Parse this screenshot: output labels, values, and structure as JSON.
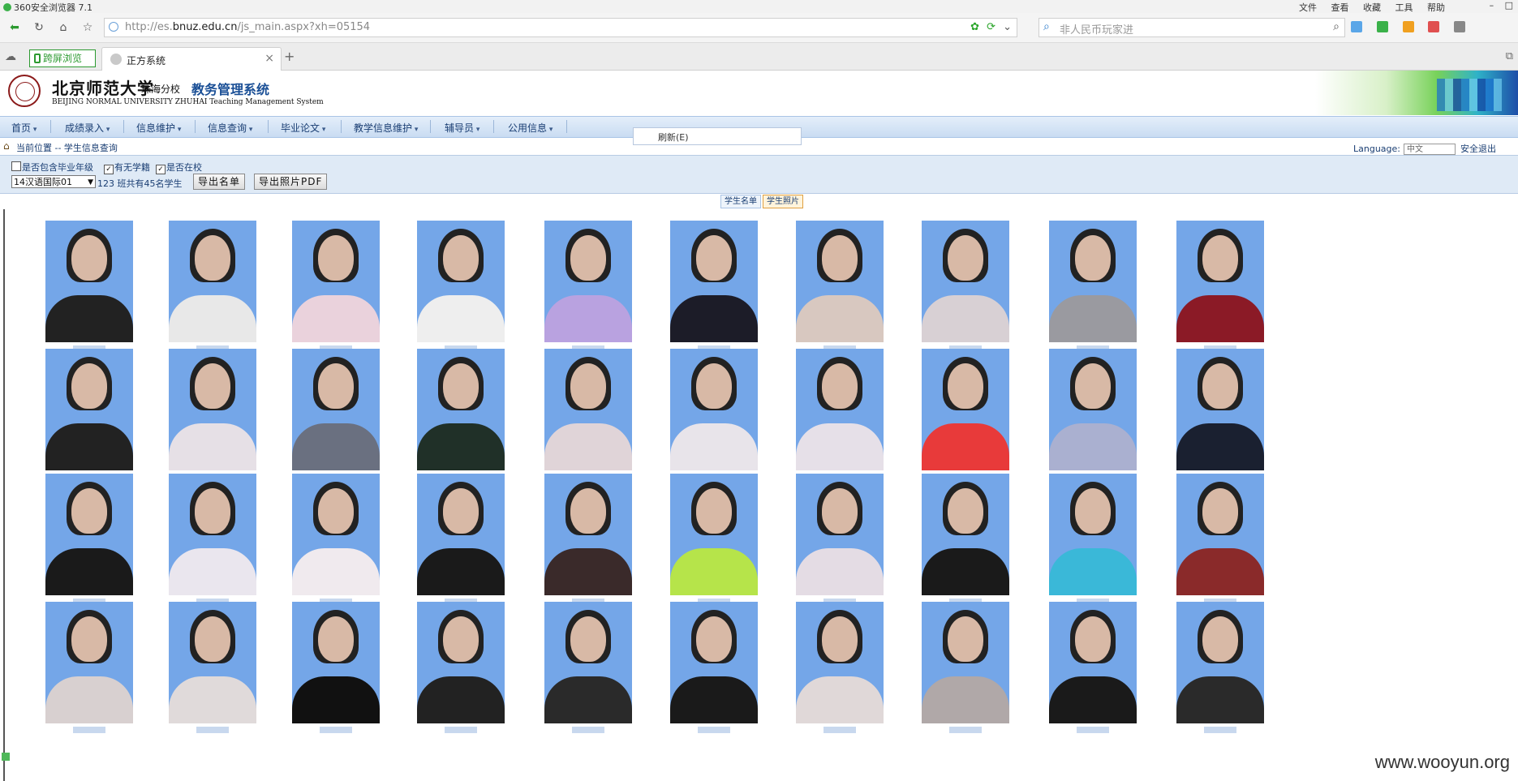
{
  "browser": {
    "title": "360安全浏览器 7.1",
    "menus": [
      "文件",
      "查看",
      "收藏",
      "工具",
      "帮助"
    ],
    "url_prefix": "http://es.",
    "url_domain": "bnuz.edu.cn",
    "url_path": "/js_main.aspx?xh=05154",
    "search_placeholder": "非人民币玩家进",
    "tab_split": "跨屏浏览",
    "tab_active": "正方系统"
  },
  "header": {
    "university": "北京师范大学",
    "campus": "珠海分校",
    "system": "教务管理系统",
    "subline": "BEIJING NORMAL UNIVERSITY ZHUHAI Teaching Management System"
  },
  "menu": {
    "items": [
      "首页",
      "成绩录入",
      "信息维护",
      "信息查询",
      "毕业论文",
      "教学信息维护",
      "辅导员",
      "公用信息"
    ],
    "popup_item": "刷新(E)"
  },
  "breadcrumb": "当前位置 -- 学生信息查询",
  "language": {
    "label": "Language:",
    "value": "中文",
    "logout": "安全退出"
  },
  "filter": {
    "include_grad_label": "是否包含毕业年级",
    "include_grad": false,
    "has_status_label": "有无学籍",
    "has_status": true,
    "in_school_label": "是否在校",
    "in_school": true,
    "class_value": "14汉语国际01",
    "count_text": "123 班共有45名学生",
    "export_list": "导出名单",
    "export_pdf": "导出照片PDF"
  },
  "subtabs": [
    "学生名单",
    "学生照片"
  ],
  "watermark": "www.wooyun.org",
  "photos": [
    {
      "body": "#222"
    },
    {
      "body": "#e8e8e8"
    },
    {
      "body": "#ead2dc"
    },
    {
      "body": "#eeeeee"
    },
    {
      "body": "#b9a2e0"
    },
    {
      "body": "#1c1c28"
    },
    {
      "body": "#d8c8c0"
    },
    {
      "body": "#d8d0d4"
    },
    {
      "body": "#9a9aa0"
    },
    {
      "body": "#8b1a26"
    },
    {
      "body": "#222"
    },
    {
      "body": "#e6e0e6"
    },
    {
      "body": "#6a7080"
    },
    {
      "body": "#203028"
    },
    {
      "body": "#e0d4d8"
    },
    {
      "body": "#e8e4ea"
    },
    {
      "body": "#e6e0e8"
    },
    {
      "body": "#e83a3a"
    },
    {
      "body": "#aab0d0"
    },
    {
      "body": "#1a2030"
    },
    {
      "body": "#1a1a1a"
    },
    {
      "body": "#eae6ee"
    },
    {
      "body": "#f0eaee"
    },
    {
      "body": "#1a1a1a"
    },
    {
      "body": "#3a2a2a"
    },
    {
      "body": "#b6e44a"
    },
    {
      "body": "#e4dce4"
    },
    {
      "body": "#1a1a1a"
    },
    {
      "body": "#3ab8d8"
    },
    {
      "body": "#8a2a2a"
    },
    {
      "body": "#d8d0d0"
    },
    {
      "body": "#e0dada"
    },
    {
      "body": "#111"
    },
    {
      "body": "#222"
    },
    {
      "body": "#2a2a2a"
    },
    {
      "body": "#1a1a1a"
    },
    {
      "body": "#e0d8d8"
    },
    {
      "body": "#b0a8a8"
    },
    {
      "body": "#1a1a1a"
    },
    {
      "body": "#2a2a2a"
    }
  ]
}
